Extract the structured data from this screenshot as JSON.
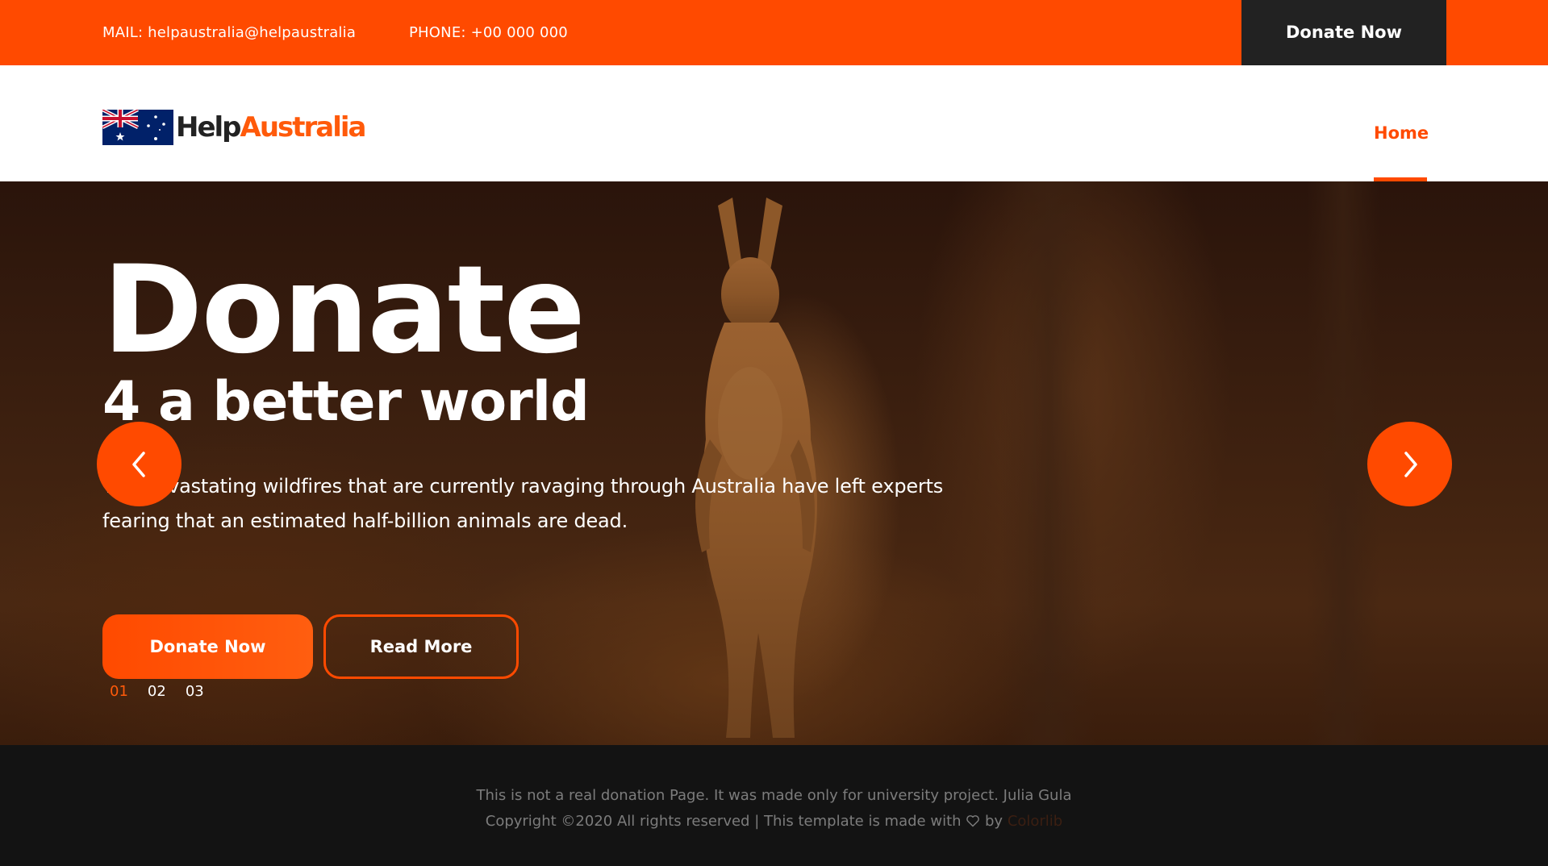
{
  "topbar": {
    "mail": "MAIL: helpaustralia@helpaustralia",
    "phone": "PHONE: +00 000 000",
    "donate_label": "Donate Now"
  },
  "header": {
    "logo_help": "Help",
    "logo_australia": "Australia",
    "nav": [
      {
        "label": "Home",
        "active": true
      }
    ]
  },
  "hero": {
    "title": "Donate",
    "subtitle": "4 a better world",
    "text": "The devastating wildfires that are currently ravaging through Australia have left experts fearing that an estimated half-billion animals are dead.",
    "primary_button": "Donate Now",
    "secondary_button": "Read More",
    "slides": [
      "01",
      "02",
      "03"
    ],
    "active_slide": "01"
  },
  "footer": {
    "line1": "This is not a real donation Page. It was made only for university project. Julia Gula",
    "line2_prefix": "Copyright ©2020 All rights reserved | This template is made with",
    "line2_by": "by",
    "credit": "Colorlib"
  },
  "colors": {
    "accent": "#ff4a00",
    "dark": "#222222",
    "footer_bg": "#131313"
  },
  "icons": [
    "australia-flag-icon",
    "chevron-left-icon",
    "chevron-right-icon",
    "heart-icon"
  ]
}
